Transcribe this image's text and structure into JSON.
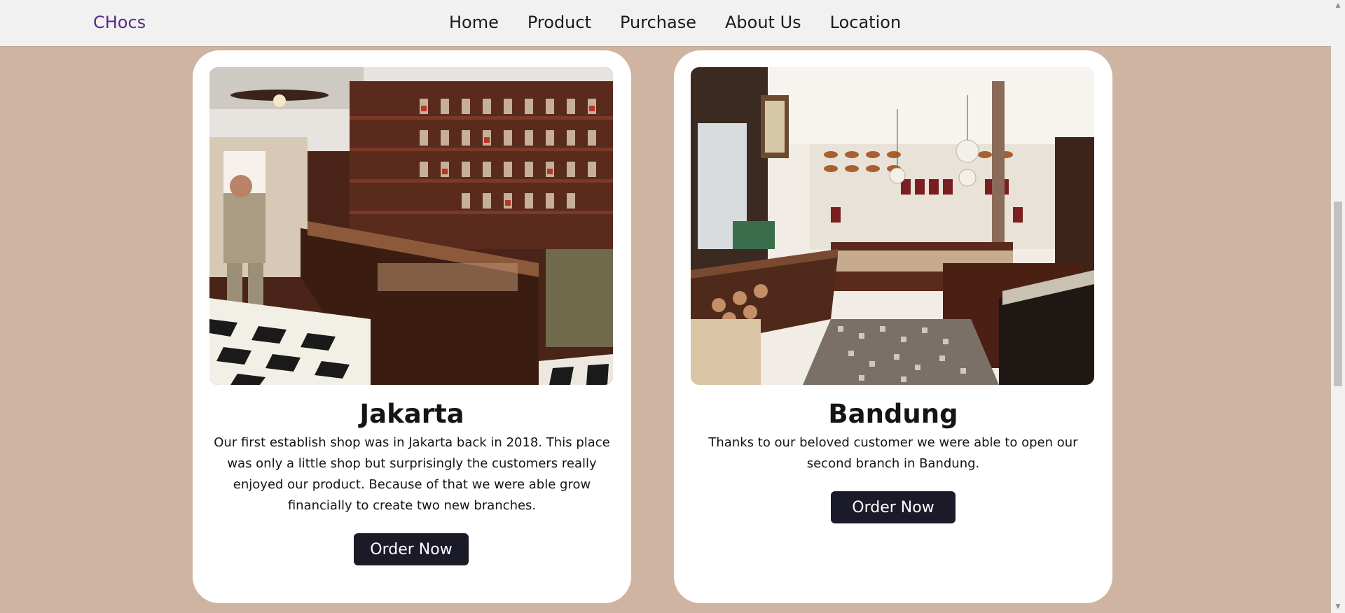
{
  "navbar": {
    "brand": "CHocs",
    "links": [
      "Home",
      "Product",
      "Purchase",
      "About Us",
      "Location"
    ]
  },
  "locations": [
    {
      "title": "Jakarta",
      "description": "Our first establish shop was in Jakarta back in 2018. This place was only a little shop but surprisingly the customers really enjoyed our product. Because of that we were able grow financially to create two new branches.",
      "button": "Order Now"
    },
    {
      "title": "Bandung",
      "description": "Thanks to our beloved customer we were able to open our second branch in Bandung.",
      "button": "Order Now"
    }
  ],
  "colors": {
    "page_background": "#cfb4a2",
    "navbar_background": "#f1f1f1",
    "brand": "#5a2a86",
    "button": "#1b1a29"
  }
}
